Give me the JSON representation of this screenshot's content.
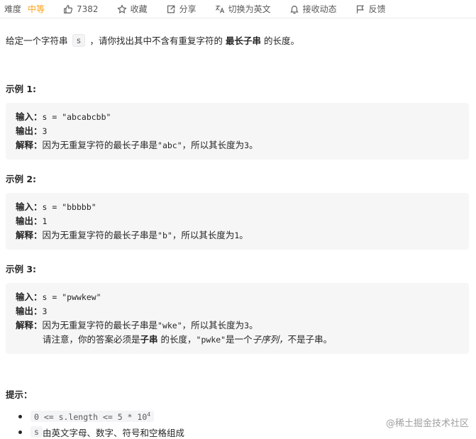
{
  "toolbar": {
    "difficulty_label": "难度",
    "difficulty_value": "中等",
    "difficulty_color": "#ffa116",
    "likes": "7382",
    "favorite": "收藏",
    "share": "分享",
    "switch_lang": "切换为英文",
    "notify": "接收动态",
    "feedback": "反馈"
  },
  "description": {
    "before": "给定一个字符串",
    "code": "s",
    "middle": "，请你找出其中不含有重复字符的",
    "bold": "最长子串",
    "after": "的长度。"
  },
  "examples": [
    {
      "title": "示例 1:",
      "input_key": "输入：",
      "input_val": "s = \"abcabcbb\"",
      "output_key": "输出：",
      "output_val": "3",
      "explain_key": "解释：",
      "explain_a": "因为无重复字符的最长子串是 ",
      "explain_code": "\"abc\"",
      "explain_b": "，所以其长度为 ",
      "explain_num": "3",
      "explain_end": "。"
    },
    {
      "title": "示例 2:",
      "input_key": "输入：",
      "input_val": "s = \"bbbbb\"",
      "output_key": "输出：",
      "output_val": "1",
      "explain_key": "解释：",
      "explain_a": "因为无重复字符的最长子串是 ",
      "explain_code": "\"b\"",
      "explain_b": "，所以其长度为 ",
      "explain_num": "1",
      "explain_end": "。"
    },
    {
      "title": "示例 3:",
      "input_key": "输入：",
      "input_val": "s = \"pwwkew\"",
      "output_key": "输出：",
      "output_val": "3",
      "explain_key": "解释：",
      "explain_a": "因为无重复字符的最长子串是 ",
      "explain_code": "\"wke\"",
      "explain_b": "，所以其长度为 ",
      "explain_num": "3",
      "explain_end": "。",
      "note_a": "请注意，你的答案必须是 ",
      "note_bold": "子串",
      "note_b": " 的长度，",
      "note_code": "\"pwke\"",
      "note_c": " 是一个",
      "note_italic": "子序列，",
      "note_d": "不是子串。"
    }
  ],
  "hints": {
    "title": "提示：",
    "item1_code": "0 <= s.length <= 5 * 10",
    "item1_sup": "4",
    "item2_code": "s",
    "item2_text": " 由英文字母、数字、符号和空格组成"
  },
  "watermark": "@稀土掘金技术社区"
}
